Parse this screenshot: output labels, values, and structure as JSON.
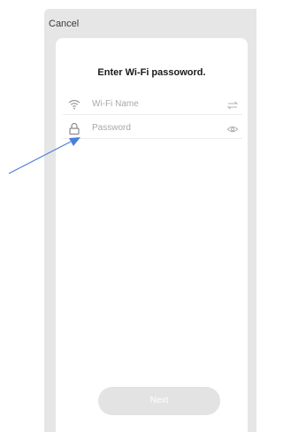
{
  "header": {
    "cancel_label": "Cancel"
  },
  "dialog": {
    "title": "Enter Wi-Fi passoword."
  },
  "wifi_field": {
    "placeholder": "Wi-Fi Name",
    "lead_icon": "wifi-icon",
    "trail_icon": "switch-icon"
  },
  "password_field": {
    "placeholder": "Password",
    "lead_icon": "lock-icon",
    "trail_icon": "eye-icon"
  },
  "next_button": {
    "label": "Next"
  },
  "colors": {
    "annotation_arrow": "#4a7fd8",
    "background": "#e6e6e6",
    "button": "#e3e3e3"
  }
}
